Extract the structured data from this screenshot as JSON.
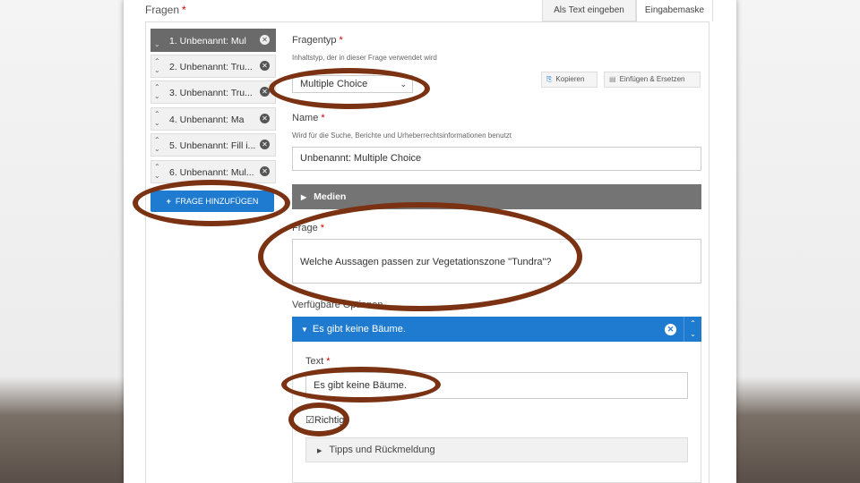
{
  "section": {
    "title": "Fragen",
    "required_mark": "*"
  },
  "tabs": [
    {
      "label": "Als Text eingeben"
    },
    {
      "label": "Eingabemaske"
    }
  ],
  "questions": [
    {
      "label": "1. Unbenannt: Mul"
    },
    {
      "label": "2. Unbenannt: Tru..."
    },
    {
      "label": "3. Unbenannt: Tru..."
    },
    {
      "label": "4. Unbenannt: Ma"
    },
    {
      "label": "5. Unbenannt: Fill i..."
    },
    {
      "label": "6. Unbenannt: Mul..."
    }
  ],
  "add_question": {
    "label": "FRAGE HINZUFÜGEN",
    "icon": "plus-icon"
  },
  "question_type": {
    "label": "Fragentyp",
    "help": "Inhaltstyp, der in dieser Frage verwendet wird",
    "selected": "Multiple Choice",
    "copy_label": "Kopieren",
    "paste_label": "Einfügen & Ersetzen"
  },
  "name": {
    "label": "Name",
    "help": "Wird für die Suche, Berichte und Urheberrechtsinformationen benutzt",
    "value": "Unbenannt: Multiple Choice"
  },
  "media": {
    "label": "Medien"
  },
  "frage": {
    "label": "Frage",
    "value": "Welche Aussagen passen zur Vegetationszone \"Tundra\"?"
  },
  "options": {
    "label": "Verfügbare Optionen",
    "item": {
      "title": "Es gibt keine Bäume.",
      "text_label": "Text",
      "text_value": "Es gibt keine Bäume.",
      "correct_label": "Richtig!",
      "correct_checked": true,
      "tips_label": "Tipps und Rückmeldung"
    }
  },
  "colors": {
    "accent": "#1f7bd0",
    "active_item": "#6a6a6a",
    "annotation_ring": "#7a3212",
    "required": "#cc0000"
  }
}
